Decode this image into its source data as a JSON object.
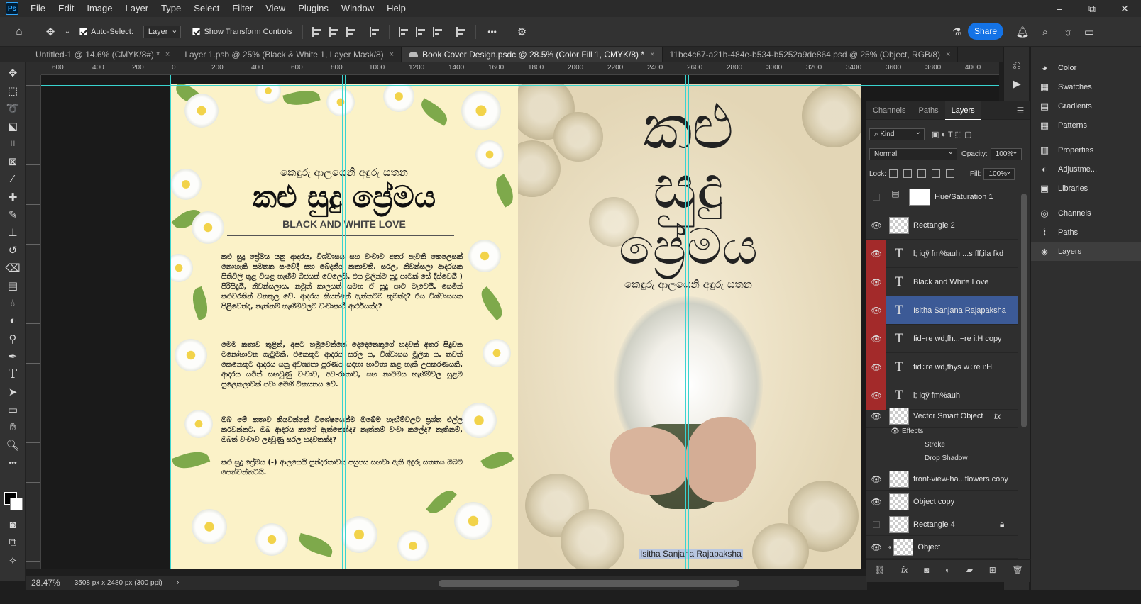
{
  "app": {
    "logo": "Ps"
  },
  "menu": [
    "File",
    "Edit",
    "Image",
    "Layer",
    "Type",
    "Select",
    "Filter",
    "View",
    "Plugins",
    "Window",
    "Help"
  ],
  "window_controls": {
    "minimize": "–",
    "restore": "⧉",
    "close": "✕"
  },
  "options": {
    "auto_select_label": "Auto-Select:",
    "auto_select_value": "Layer",
    "show_transform_label": "Show Transform Controls",
    "more": "•••",
    "share": "Share"
  },
  "tabs": [
    {
      "label": "Untitled-1 @ 14.6% (CMYK/8#) *",
      "active": false
    },
    {
      "label": "Layer 1.psb @ 25% (Black & White 1, Layer Mask/8)",
      "active": false
    },
    {
      "label": "Book Cover Design.psdc @ 28.5% (Color Fill 1, CMYK/8) *",
      "active": true
    },
    {
      "label": "11bc4c67-a21b-484e-b534-b5252a9de864.psd @ 25% (Object, RGB/8)",
      "active": false
    }
  ],
  "tab_close": "×",
  "ruler": {
    "top_labels": [
      "600",
      "400",
      "200",
      "0",
      "200",
      "400",
      "600",
      "800",
      "1000",
      "1200",
      "1400",
      "1600",
      "1800",
      "2000",
      "2200",
      "2400",
      "2600",
      "2800",
      "3000",
      "3200",
      "3400",
      "3600",
      "3800",
      "4000"
    ]
  },
  "back_cover": {
    "tagline": "කෙඳුරු ආලයෙනි අඳුරු සතන",
    "title": "කළු සුදු ප්‍රේමය",
    "subtitle_en": "BLACK AND WHITE LOVE",
    "paragraphs": [
      "කළු සුදු ප්‍රේමය යනු ආදරය, විශ්වාසය සහ වංචාව අතර පැවති කෙලෙසක් නොහැකි සමනක සංවේදී සහ බේදනීය කතාවකි. සරල, නිවන්සලා ආදරයක සිතිවිලි තුළ වියළ හැඟීම් බීජයක් වෙලෙසී. එය මුලින්ම සුදු පාටක් සේ දිස්වෙයි ) පිරිසිදුයි, නිවන්සලාය. නමුත් කාලයත් සමඟ ඒ සුදු පාට මැවෙයි. සෙමින් කළුවරකින් වනකුල වේ. ආදරය කියන්නේ ඇත්තටම කුමක්ද? එය විශ්වාසයක පිළිවෙත්ද, නැත්නම් හැඟීම්වලට වංචාකාරී ආර්ථයක්ද?",
      "මෙම කතාව තුළින්, අපට හමුවෙන්නේ දෙදෙනෙකුගේ හදවත් අතර සිදුවන මනෝභාවන ගැටුමකි. එකෙකුට ආදරය සරල ය, විශ්වාසය මූලික ය. තවත් කෙනෙකුට ආදරය යනු අවශ්‍යතා පූරණය සඳහා භාවිතා කළ හැකි උපකරණයකි. ආදරය යටින් සඟවුණු වංචාව, අව-රාතාව, සහ නාටමය හැඟීම්වල සුළම සුලෙකලාවක් පවා මෙහි විකසනය වේ.",
      "ඔබ මේ කතාව කියවන්නේ විශේෂයෙන්ම ඔබේම හැඟීම්වලට ප්‍රශ්න එල්ල කරවන්නට. ඔබ ආදරය කාගේ ඇත්තෙන්ද? නැත්නම් වංචා කලේද? නැතිනම්, ඔබත් වංචාව ලඳවුණු සරල හදවතක්ද?",
      "කළු සුදු ප්‍රේමය (-) ආලයෙයි සුන්දරතාවය පසුපස සඟවා ඇති අඳුරු සතතය ඔබට පෙන්වන්නටයි."
    ]
  },
  "front_cover": {
    "title_line1": "කළු",
    "title_line2": "සුදු",
    "title_line3": "ප්‍රේමය",
    "tagline": "කෙඳුරු ආලයෙනි අඳුරු සතන",
    "author": "Isitha Sanjana Rajapaksha"
  },
  "status": {
    "zoom": "28.47%",
    "doc_info": "3508 px x 2480 px (300 ppi)",
    "arrow": "›"
  },
  "right_column": {
    "group1": [
      "Color",
      "Swatches",
      "Gradients",
      "Patterns"
    ],
    "group2": [
      "Properties",
      "Adjustme...",
      "Libraries"
    ],
    "group3": [
      "Channels",
      "Paths",
      "Layers"
    ]
  },
  "layers_panel": {
    "tabs": [
      "Channels",
      "Paths",
      "Layers"
    ],
    "filter_label": "Kind",
    "blend_mode": "Normal",
    "opacity_label": "Opacity:",
    "opacity_value": "100%",
    "lock_label": "Lock:",
    "fill_label": "Fill:",
    "fill_value": "100%",
    "layers": [
      {
        "name": "Hue/Saturation 1",
        "kind": "adjustment",
        "visible": false,
        "red": false,
        "selected": false
      },
      {
        "name": "Rectangle 2",
        "kind": "shape",
        "visible": true,
        "red": false,
        "selected": false
      },
      {
        "name": "l; iqÿ fm%auh ...s flf,ila fkd",
        "kind": "text",
        "visible": true,
        "red": true,
        "selected": false
      },
      {
        "name": "Black and White Love",
        "kind": "text",
        "visible": true,
        "red": true,
        "selected": false
      },
      {
        "name": "Isitha Sanjana Rajapaksha",
        "kind": "text",
        "visible": true,
        "red": true,
        "selected": true
      },
      {
        "name": "fid÷re wd,fh...÷re i:H copy",
        "kind": "text",
        "visible": true,
        "red": true,
        "selected": false
      },
      {
        "name": "fid÷re wd,fhys w÷re i:H",
        "kind": "text",
        "visible": true,
        "red": true,
        "selected": false
      },
      {
        "name": "l; iqÿ fm%auh",
        "kind": "text",
        "visible": true,
        "red": true,
        "selected": false
      },
      {
        "name": "Vector Smart Object",
        "kind": "smart",
        "visible": true,
        "red": false,
        "selected": false
      }
    ],
    "effects_label": "Effects",
    "effects": [
      "Stroke",
      "Drop Shadow"
    ],
    "fx_label": "fx",
    "layers_lower": [
      {
        "name": "front-view-ha...flowers copy",
        "kind": "image",
        "visible": true
      },
      {
        "name": "Object copy",
        "kind": "image",
        "visible": true
      },
      {
        "name": "Rectangle 4",
        "kind": "shape",
        "visible": false
      },
      {
        "name": "Object",
        "kind": "image",
        "visible": true
      }
    ]
  }
}
